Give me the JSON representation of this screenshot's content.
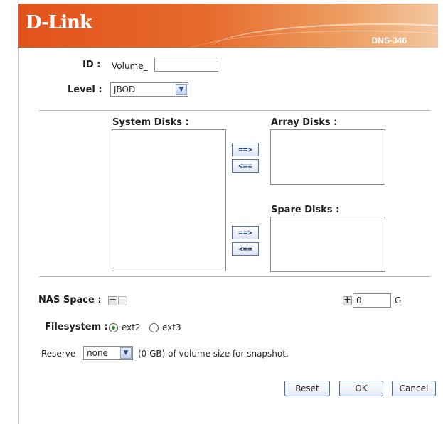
{
  "header": {
    "brand": "D-Link",
    "model": "DNS-346"
  },
  "form": {
    "id_label": "ID :",
    "id_value": "Volume_",
    "level_label": "Level :",
    "level_value": "JBOD",
    "system_disks_label": "System Disks :",
    "array_disks_label": "Array Disks :",
    "spare_disks_label": "Spare Disks :",
    "move_right": "==>",
    "move_left": "<==",
    "nas_space_label": "NAS Space :",
    "nas_space_minus": "−",
    "nas_space_plus": "+",
    "nas_space_value": "0",
    "nas_space_unit": "G",
    "filesystem_label": "Filesystem :",
    "fs_options": [
      "ext2",
      "ext3"
    ],
    "fs_selected": "ext2",
    "reserve_label": "Reserve",
    "reserve_value": "none",
    "reserve_suffix": "(0 GB) of volume size for snapshot.",
    "dropdown_arrow": "▼"
  },
  "buttons": {
    "reset": "Reset",
    "ok": "OK",
    "cancel": "Cancel"
  },
  "colors": {
    "header_start": "#e2521b",
    "header_end": "#f3c8a3",
    "button_border": "#4f6ea8"
  }
}
